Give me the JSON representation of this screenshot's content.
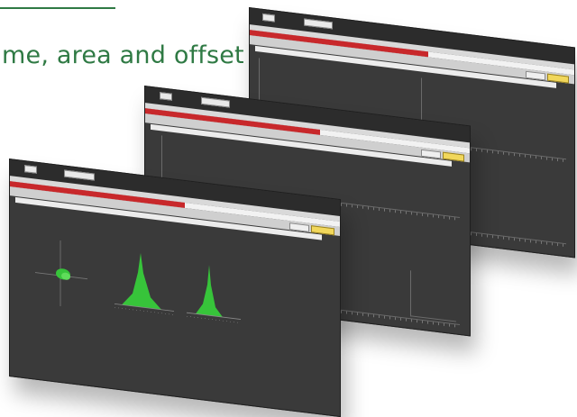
{
  "headline": {
    "text": "me, area and offset"
  },
  "colors": {
    "accent_green": "#2f7a44",
    "progress_red": "#c8282b",
    "button_yellow": "#f1d75b",
    "peak_green": "#37c43a"
  },
  "screens": {
    "back": {
      "progress_fraction": 0.55
    },
    "mid": {
      "progress_fraction": 0.54
    },
    "front": {
      "progress_fraction": 0.53
    }
  }
}
